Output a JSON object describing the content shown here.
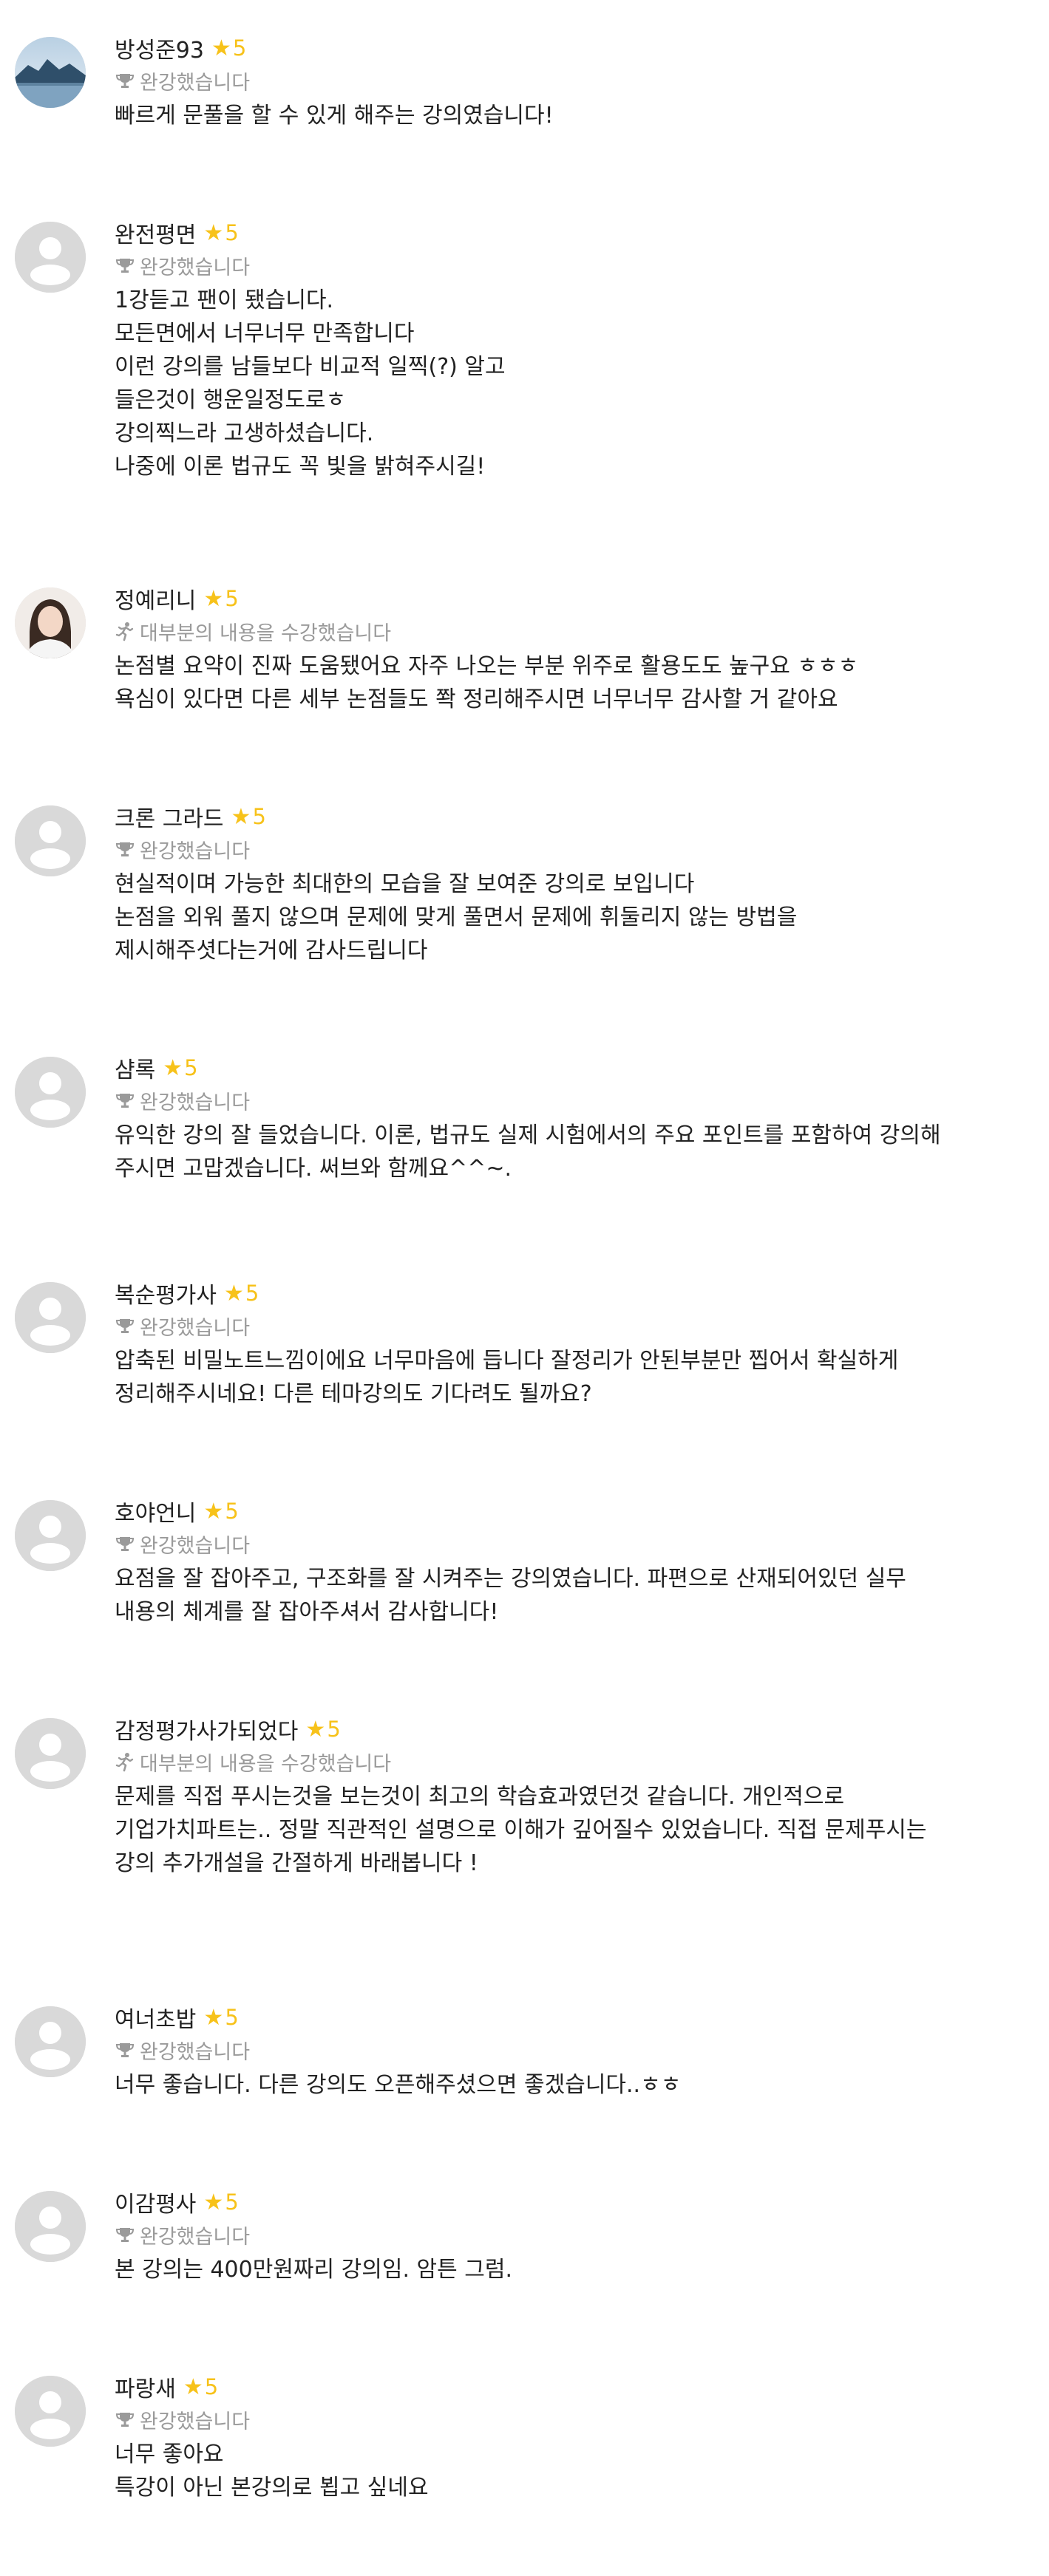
{
  "colors": {
    "star": "#f7c21a",
    "status_text": "#9a9a9a",
    "avatar_placeholder": "#d9d9d9",
    "body_text": "#222222"
  },
  "reviews": [
    {
      "name": "방성준93",
      "rating": "5",
      "status": "완강했습니다",
      "status_icon": "trophy-icon",
      "avatar": "landscape-photo",
      "lines": [
        "빠르게 문풀을 할 수 있게 해주는 강의였습니다!"
      ]
    },
    {
      "name": "완전평면",
      "rating": "5",
      "status": "완강했습니다",
      "status_icon": "trophy-icon",
      "avatar": "default-user",
      "lines": [
        "1강듣고 팬이 됐습니다.",
        "모든면에서 너무너무 만족합니다",
        "이런 강의를 남들보다 비교적 일찍(?) 알고",
        "들은것이 행운일정도로ㅎ",
        "강의찍느라 고생하셨습니다.",
        "나중에 이론 법규도 꼭 빛을 밝혀주시길!"
      ]
    },
    {
      "name": "정예리니",
      "rating": "5",
      "status": "대부분의 내용을 수강했습니다",
      "status_icon": "runner-icon",
      "avatar": "person-photo",
      "lines": [
        "논점별 요약이 진짜 도움됐어요 자주 나오는 부분 위주로 활용도도 높구요 ㅎㅎㅎ",
        "욕심이 있다면 다른 세부 논점들도 쫙 정리해주시면 너무너무 감사할 거 같아요"
      ]
    },
    {
      "name": "크론 그라드",
      "rating": "5",
      "status": "완강했습니다",
      "status_icon": "trophy-icon",
      "avatar": "default-user",
      "lines": [
        "현실적이며 가능한 최대한의 모습을 잘 보여준 강의로 보입니다",
        "논점을 외워 풀지 않으며 문제에 맞게 풀면서 문제에 휘둘리지 않는 방법을",
        "제시해주셧다는거에 감사드립니다"
      ]
    },
    {
      "name": "샴록",
      "rating": "5",
      "status": "완강했습니다",
      "status_icon": "trophy-icon",
      "avatar": "default-user",
      "lines": [
        "유익한 강의 잘 들었습니다. 이론, 법규도 실제 시험에서의 주요 포인트를 포함하여 강의해",
        "주시면 고맙겠습니다. 써브와 함께요^^~."
      ]
    },
    {
      "name": "복순평가사",
      "rating": "5",
      "status": "완강했습니다",
      "status_icon": "trophy-icon",
      "avatar": "default-user",
      "lines": [
        "압축된 비밀노트느낌이에요 너무마음에 듭니다 잘정리가 안된부분만 찝어서 확실하게",
        "정리해주시네요! 다른 테마강의도 기다려도 될까요?"
      ]
    },
    {
      "name": "호야언니",
      "rating": "5",
      "status": "완강했습니다",
      "status_icon": "trophy-icon",
      "avatar": "default-user",
      "lines": [
        "요점을 잘 잡아주고, 구조화를 잘 시켜주는 강의였습니다. 파편으로 산재되어있던 실무",
        "내용의 체계를 잘 잡아주셔서 감사합니다!"
      ]
    },
    {
      "name": "감정평가사가되었다",
      "rating": "5",
      "status": "대부분의 내용을 수강했습니다",
      "status_icon": "runner-icon",
      "avatar": "default-user",
      "lines": [
        "문제를 직접 푸시는것을 보는것이 최고의 학습효과였던것 같습니다. 개인적으로",
        "기업가치파트는.. 정말 직관적인 설명으로 이해가 깊어질수 있었습니다. 직접 문제푸시는",
        "강의 추가개설을 간절하게 바래봅니다 !"
      ]
    },
    {
      "name": "여너초밥",
      "rating": "5",
      "status": "완강했습니다",
      "status_icon": "trophy-icon",
      "avatar": "default-user",
      "lines": [
        "너무 좋습니다. 다른 강의도 오픈해주셨으면 좋겠습니다..ㅎㅎ"
      ]
    },
    {
      "name": "이감평사",
      "rating": "5",
      "status": "완강했습니다",
      "status_icon": "trophy-icon",
      "avatar": "default-user",
      "lines": [
        "본 강의는 400만원짜리 강의임. 암튼 그럼."
      ]
    },
    {
      "name": "파랑새",
      "rating": "5",
      "status": "완강했습니다",
      "status_icon": "trophy-icon",
      "avatar": "default-user",
      "lines": [
        "너무 좋아요",
        "특강이 아닌 본강의로 뵙고 싶네요"
      ]
    }
  ]
}
